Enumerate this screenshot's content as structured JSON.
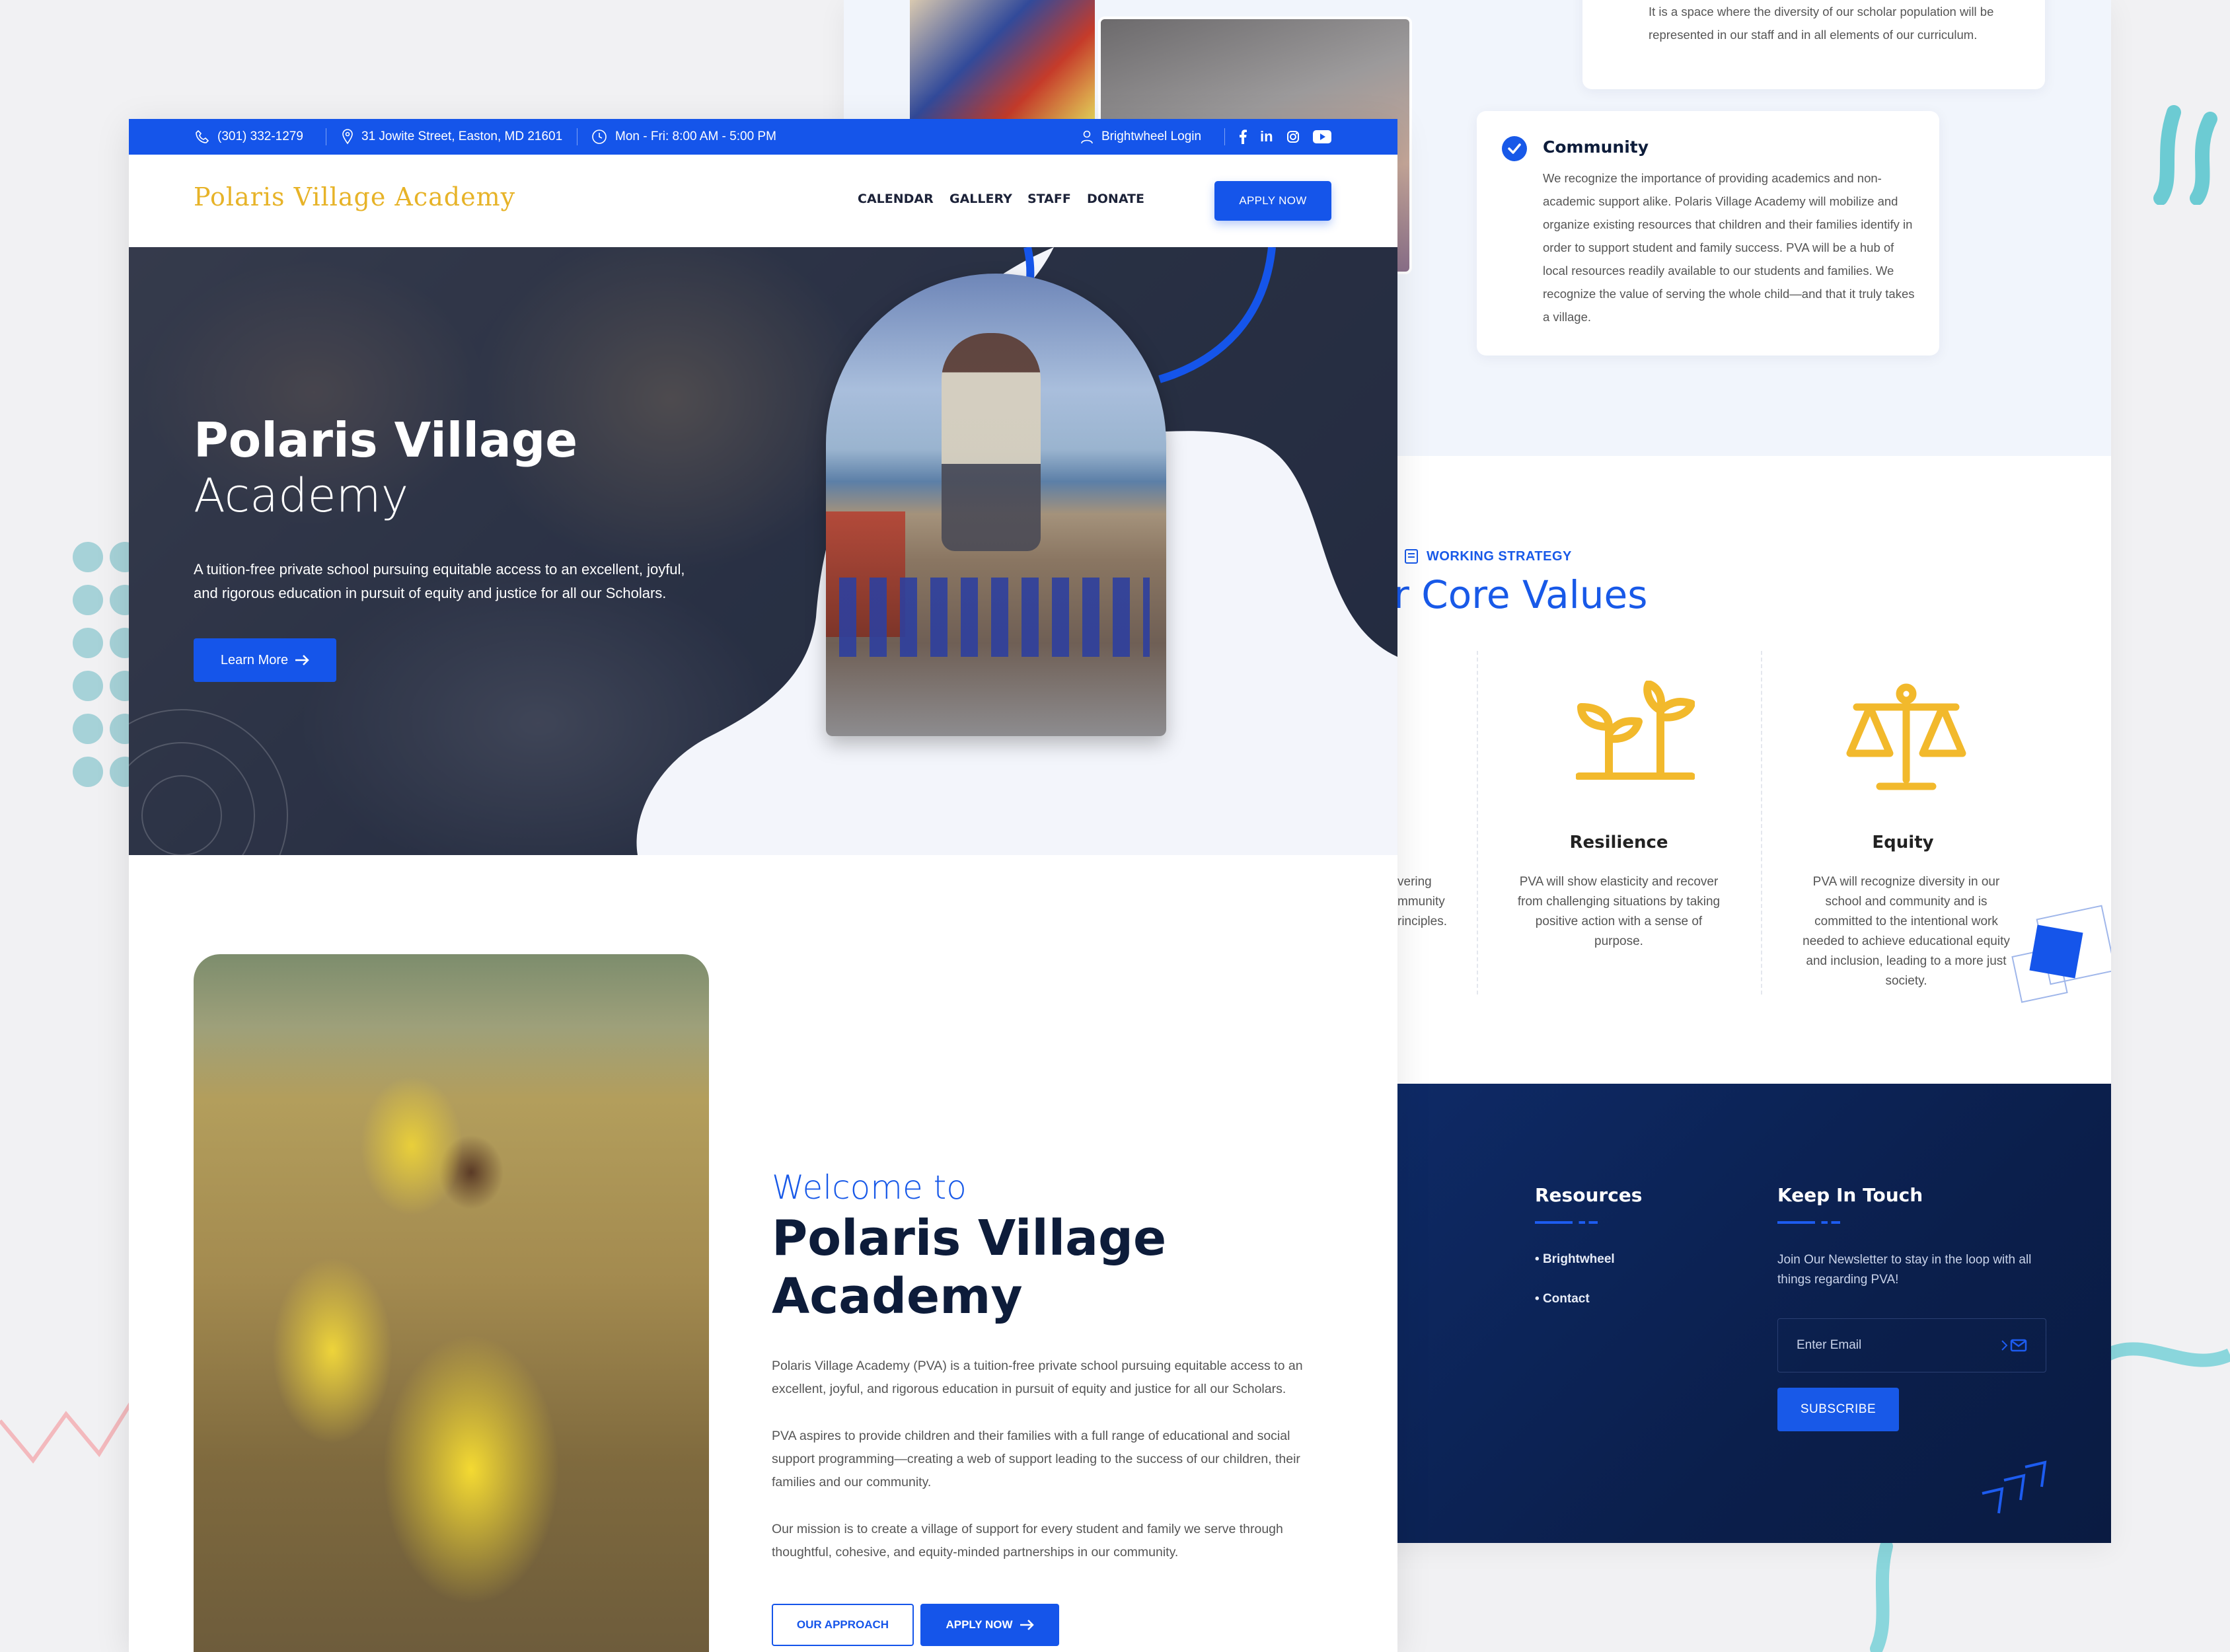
{
  "topbar": {
    "phone": "(301) 332-1279",
    "address": "31 Jowite Street, Easton, MD 21601",
    "hours": "Mon - Fri: 8:00 AM - 5:00 PM",
    "login": "Brightwheel Login",
    "social": [
      "facebook-icon",
      "linkedin-icon",
      "instagram-icon",
      "youtube-icon"
    ]
  },
  "nav": {
    "logo": "Polaris Village Academy",
    "items": [
      "CALENDAR",
      "GALLERY",
      "STAFF",
      "DONATE"
    ],
    "apply": "APPLY NOW"
  },
  "hero": {
    "title_line1": "Polaris Village",
    "title_line2": "Academy",
    "text": "A tuition-free private school pursuing equitable access to an excellent, joyful, and rigorous education in pursuit of equity and justice for all our Scholars.",
    "cta": "Learn More"
  },
  "welcome": {
    "small": "Welcome to",
    "title_line1": "Polaris Village",
    "title_line2": "Academy",
    "paragraphs": [
      "Polaris Village Academy (PVA) is a tuition-free private school pursuing equitable access to an excellent, joyful, and rigorous education in pursuit of equity and justice for all our Scholars.",
      "PVA aspires to provide children and their families with a full range of educational and social support programming—creating a web of support leading to the success of our children, their families and our community.",
      "Our mission is to create a village of support for every student and family we serve through thoughtful, cohesive, and equity-minded partnerships in our community."
    ],
    "btn_approach": "OUR APPROACH",
    "btn_apply": "APPLY NOW"
  },
  "back": {
    "top_card_text": "It is a space where the diversity of our scholar population will be represented in our staff and in all elements of our curriculum.",
    "community": {
      "title": "Community",
      "text": "We recognize the importance of providing academics and non-academic support alike. Polaris Village Academy will mobilize and organize existing resources that children and their families identify in order to support student and family success. PVA will be a hub of local resources readily available to our students and families. We recognize the value of serving the whole child—and that it truly takes a village."
    },
    "eyebrow": "WORKING STRATEGY",
    "core_title": "r Core Values",
    "partial_text": [
      "vering",
      "mmunity",
      "rinciples."
    ],
    "values": [
      {
        "title": "Resilience",
        "text": "PVA will show elasticity and recover from challenging situations by taking positive action with a sense of purpose.",
        "icon": "sprout-icon"
      },
      {
        "title": "Equity",
        "text": "PVA will recognize diversity in our school and community and is committed to the intentional work needed to achieve educational equity and inclusion, leading to a more just society.",
        "icon": "scales-icon"
      }
    ],
    "footer": {
      "resources_title": "Resources",
      "links": [
        "Brightwheel",
        "Contact"
      ],
      "keep_title": "Keep In Touch",
      "keep_text": "Join Our Newsletter to stay in the loop with all things regarding PVA!",
      "email_placeholder": "Enter Email",
      "subscribe": "SUBSCRIBE"
    }
  },
  "colors": {
    "primary": "#1555ea",
    "accent_gold": "#e7b328",
    "dark_navy": "#0b1f4c"
  }
}
